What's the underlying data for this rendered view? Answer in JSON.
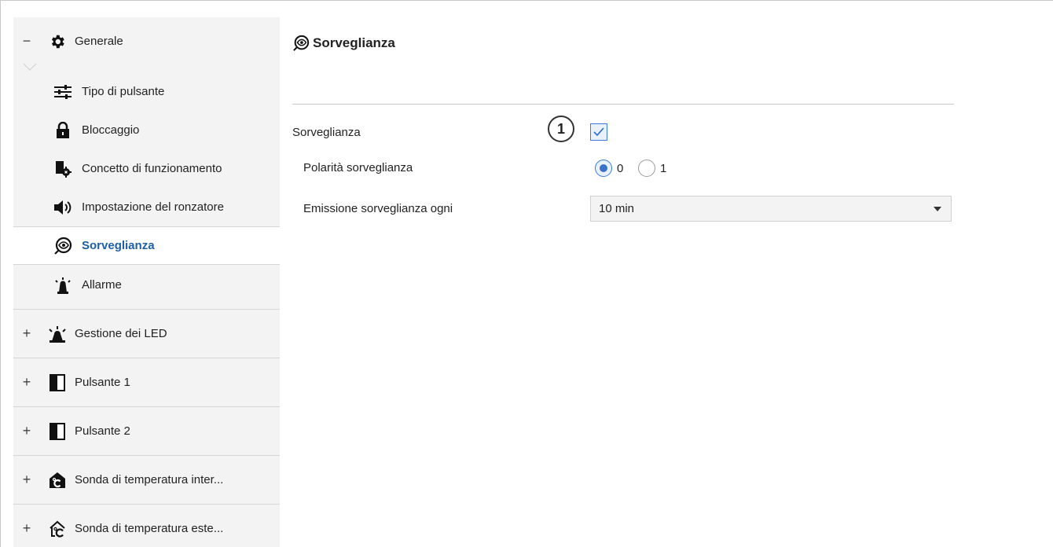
{
  "sidebar": {
    "groups": [
      {
        "toggle": "−",
        "label": "Generale",
        "icon": "gear-icon",
        "items": [
          {
            "label": "Tipo di pulsante",
            "icon": "sliders-icon"
          },
          {
            "label": "Bloccaggio",
            "icon": "lock-icon"
          },
          {
            "label": "Concetto di funzionamento",
            "icon": "concept-gear-icon"
          },
          {
            "label": "Impostazione del ronzatore",
            "icon": "speaker-icon"
          },
          {
            "label": "Sorveglianza",
            "icon": "surveillance-eye-icon",
            "active": true
          },
          {
            "label": "Allarme",
            "icon": "alarm-light-icon"
          }
        ]
      },
      {
        "toggle": "+",
        "label": "Gestione dei LED",
        "icon": "led-light-icon"
      },
      {
        "toggle": "+",
        "label": "Pulsante 1",
        "icon": "button-panel-icon"
      },
      {
        "toggle": "+",
        "label": "Pulsante 2",
        "icon": "button-panel-icon"
      },
      {
        "toggle": "+",
        "label": "Sonda di temperatura inter...",
        "icon": "house-temperature-filled-icon"
      },
      {
        "toggle": "+",
        "label": "Sonda di temperatura este...",
        "icon": "house-temperature-outline-icon"
      }
    ]
  },
  "main": {
    "title": "Sorveglianza",
    "title_icon": "surveillance-eye-icon",
    "surveillance": {
      "label": "Sorveglianza",
      "badge": "1",
      "checked": true
    },
    "polarity": {
      "label": "Polarità sorveglianza",
      "options": [
        "0",
        "1"
      ],
      "selected": "0"
    },
    "interval": {
      "label": "Emissione sorveglianza ogni",
      "value": "10 min"
    }
  },
  "colors": {
    "accent": "#1f5fa6",
    "checkbox_border": "#3b7dd8",
    "sidebar_bg": "#f3f3f3"
  }
}
